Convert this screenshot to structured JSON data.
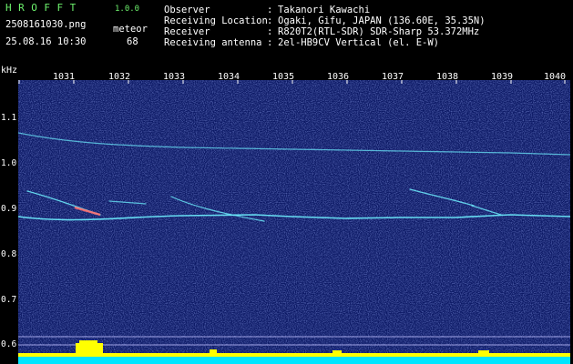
{
  "header": {
    "app_title": "HROFFT",
    "version": "1.0.0",
    "filename": "2508161030.png",
    "datetime": "25.08.16 10:30",
    "meteor_label": "meteor",
    "meteor_count": "68"
  },
  "info": [
    {
      "key": "Observer",
      "value": "Takanori Kawachi"
    },
    {
      "key": "Receiving Location",
      "value": "Ogaki, Gifu, JAPAN (136.60E, 35.35N)"
    },
    {
      "key": "Receiver",
      "value": "R820T2(RTL-SDR) SDR-Sharp 53.372MHz"
    },
    {
      "key": "Receiving antenna",
      "value": "2el-HB9CV Vertical (el. E-W)"
    }
  ],
  "axis": {
    "y_unit": "kHz",
    "x_ticks": [
      "1031",
      "1032",
      "1033",
      "1034",
      "1035",
      "1036",
      "1037",
      "1038",
      "1039",
      "1040"
    ],
    "y_ticks": [
      "1.1",
      "1.0",
      "0.9",
      "0.8",
      "0.7",
      "0.6"
    ]
  },
  "colors": {
    "background": "#0d1a66",
    "title_green": "#6df26d",
    "trace": "#6ef0ff",
    "bar_yellow": "#ffff00",
    "bar_cyan": "#00e5ff"
  }
}
